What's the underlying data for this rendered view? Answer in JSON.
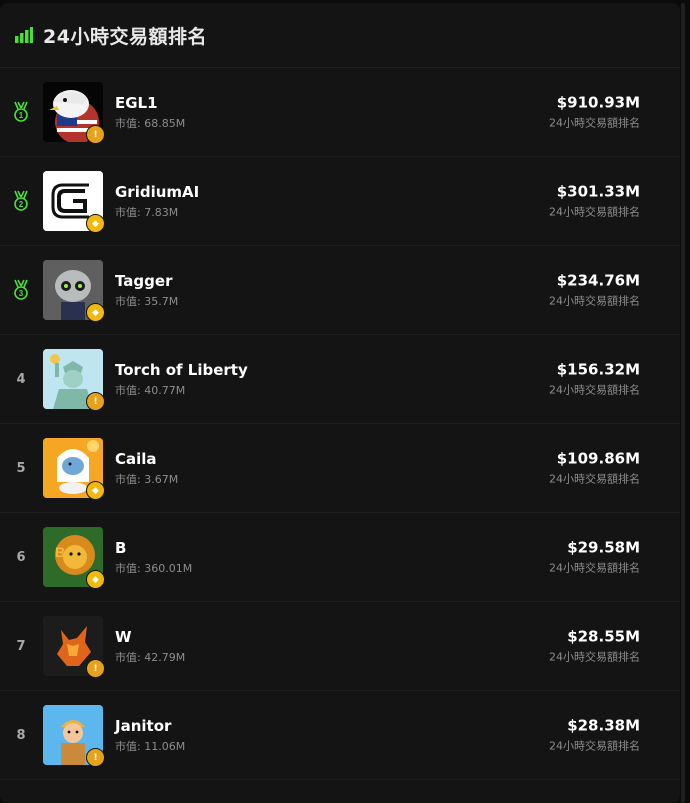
{
  "header": {
    "title": "24小時交易額排名",
    "icon": "bar-chart-icon",
    "accent": "#4ade3a"
  },
  "mcap_prefix": "市值: ",
  "rows": [
    {
      "rank": "1",
      "medal": true,
      "name": "EGL1",
      "mcap": "68.85M",
      "volume": "$910.93M",
      "volume_label": "24小時交易額排名",
      "badge": "flame"
    },
    {
      "rank": "2",
      "medal": true,
      "name": "GridiumAI",
      "mcap": "7.83M",
      "volume": "$301.33M",
      "volume_label": "24小時交易額排名",
      "badge": "bnb"
    },
    {
      "rank": "3",
      "medal": true,
      "name": "Tagger",
      "mcap": "35.7M",
      "volume": "$234.76M",
      "volume_label": "24小時交易額排名",
      "badge": "bnb"
    },
    {
      "rank": "4",
      "medal": false,
      "name": "Torch of Liberty",
      "mcap": "40.77M",
      "volume": "$156.32M",
      "volume_label": "24小時交易額排名",
      "badge": "flame"
    },
    {
      "rank": "5",
      "medal": false,
      "name": "Caila",
      "mcap": "3.67M",
      "volume": "$109.86M",
      "volume_label": "24小時交易額排名",
      "badge": "bnb"
    },
    {
      "rank": "6",
      "medal": false,
      "name": "B",
      "mcap": "360.01M",
      "volume": "$29.58M",
      "volume_label": "24小時交易額排名",
      "badge": "bnb"
    },
    {
      "rank": "7",
      "medal": false,
      "name": "W",
      "mcap": "42.79M",
      "volume": "$28.55M",
      "volume_label": "24小時交易額排名",
      "badge": "flame"
    },
    {
      "rank": "8",
      "medal": false,
      "name": "Janitor",
      "mcap": "11.06M",
      "volume": "$28.38M",
      "volume_label": "24小時交易額排名",
      "badge": "flame"
    }
  ]
}
